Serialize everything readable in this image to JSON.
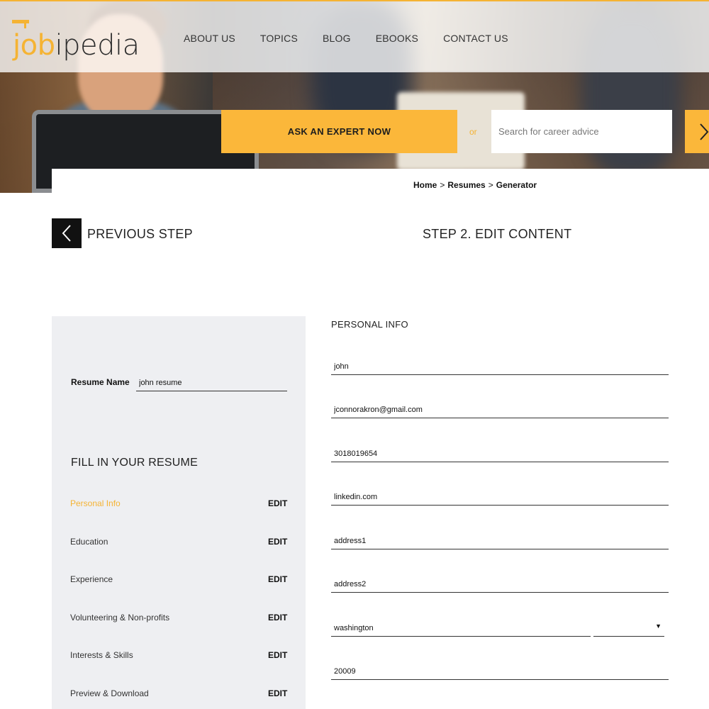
{
  "header": {
    "logo": {
      "part1": "job",
      "part2": "ipedia"
    },
    "nav": [
      "ABOUT US",
      "TOPICS",
      "BLOG",
      "EBOOKS",
      "CONTACT US"
    ],
    "ask_expert": "ASK AN EXPERT NOW",
    "or_text": "or",
    "search_placeholder": "Search for career advice"
  },
  "breadcrumb": {
    "home": "Home",
    "sep": ">",
    "resumes": "Resumes",
    "generator": "Generator"
  },
  "steps": {
    "previous": "PREVIOUS STEP",
    "current": "STEP 2. EDIT CONTENT"
  },
  "sidebar": {
    "resume_name_label": "Resume Name",
    "resume_name_value": "john resume",
    "fill_title": "FILL IN YOUR RESUME",
    "edit_label": "EDIT",
    "sections": [
      "Personal Info",
      "Education",
      "Experience",
      "Volunteering & Non-profits",
      "Interests & Skills",
      "Preview & Download"
    ],
    "active_section": "Personal Info"
  },
  "form": {
    "title": "PERSONAL INFO",
    "name": "john",
    "email": "jconnorakron@gmail.com",
    "phone": "3018019654",
    "website": "linkedin.com",
    "address1": "address1",
    "address2": "address2",
    "city": "washington",
    "state": "",
    "zip": "20009"
  },
  "colors": {
    "accent": "#fbb73a",
    "sidebar_bg": "#eeeff2",
    "dark_button": "#111111"
  },
  "icons": {
    "previous": "chevron-left-icon",
    "search": "chevron-right-icon",
    "dropdown": "caret-down-icon",
    "logo_cap": "graduation-cap-icon"
  }
}
